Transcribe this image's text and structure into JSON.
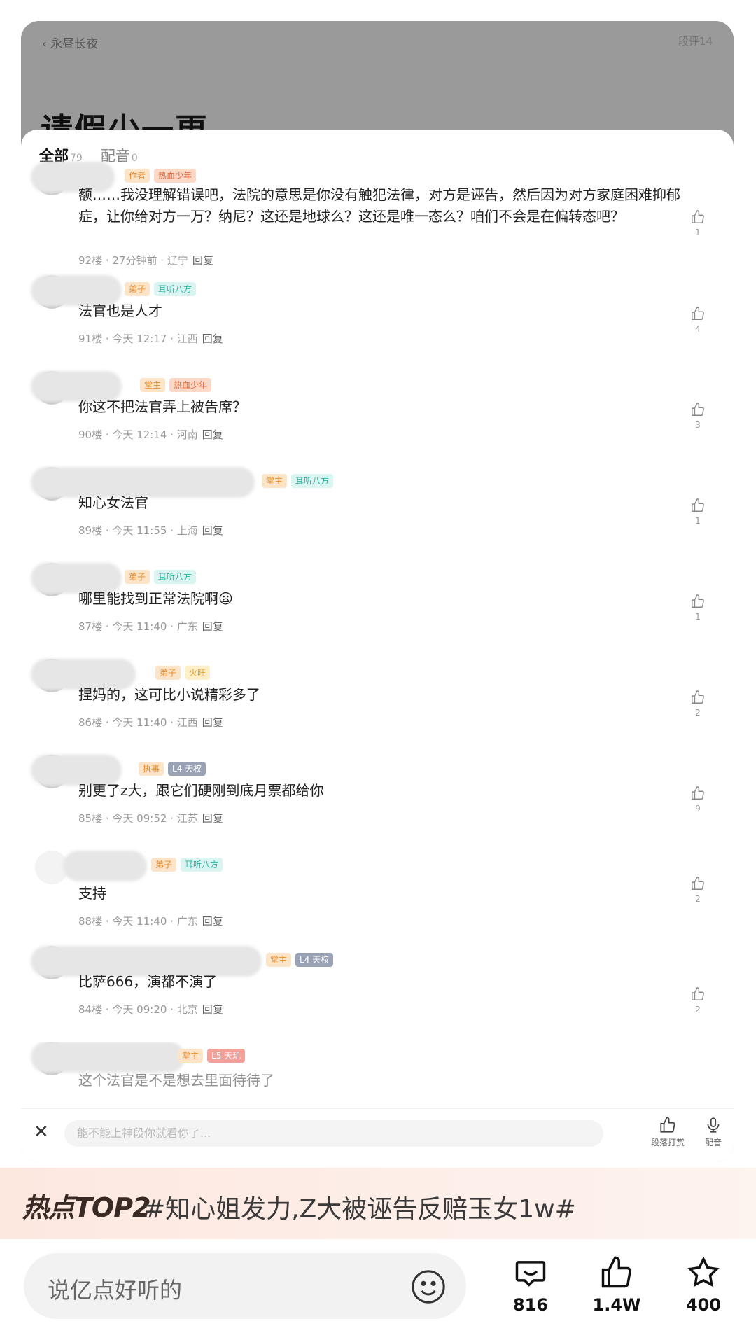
{
  "header": {
    "back_label": "永昼长夜",
    "paragraph_count": "段评14",
    "chapter_title": "请假少一更"
  },
  "tabs": [
    {
      "label": "全部",
      "count": "79"
    },
    {
      "label": "配音",
      "count": "0"
    }
  ],
  "comments": [
    {
      "badges": [
        "作者",
        "热血少年"
      ],
      "text": "额……我没理解错误吧，法院的意思是你没有触犯法律，对方是诬告，然后因为对方家庭困难抑郁症，让你给对方一万？纳尼？这还是地球么？这还是唯一态么？咱们不会是在偏转态吧？",
      "floor": "92楼",
      "time": "27分钟前",
      "region": "辽宁",
      "reply": "回复",
      "likes": "1"
    },
    {
      "badges": [
        "弟子",
        "耳听八方"
      ],
      "text": "法官也是人才",
      "floor": "91楼",
      "time": "今天 12:17",
      "region": "江西",
      "reply": "回复",
      "likes": "4"
    },
    {
      "badges": [
        "堂主",
        "热血少年"
      ],
      "text": "你这不把法官弄上被告席？",
      "floor": "90楼",
      "time": "今天 12:14",
      "region": "河南",
      "reply": "回复",
      "likes": "3"
    },
    {
      "badges": [
        "堂主",
        "耳听八方"
      ],
      "text": "知心女法官",
      "floor": "89楼",
      "time": "今天 11:55",
      "region": "上海",
      "reply": "回复",
      "likes": "1"
    },
    {
      "badges": [
        "弟子",
        "耳听八方"
      ],
      "text": "哪里能找到正常法院啊😦",
      "floor": "87楼",
      "time": "今天 11:40",
      "region": "广东",
      "reply": "回复",
      "likes": "1"
    },
    {
      "badges": [
        "弟子",
        "火旺"
      ],
      "text": "捏妈的，这可比小说精彩多了",
      "floor": "86楼",
      "time": "今天 11:40",
      "region": "江西",
      "reply": "回复",
      "likes": "2"
    },
    {
      "badges": [
        "执事",
        "L4 天权"
      ],
      "text": "别更了z大，跟它们硬刚到底月票都给你",
      "floor": "85楼",
      "time": "今天 09:52",
      "region": "江苏",
      "reply": "回复",
      "likes": "9"
    },
    {
      "badges": [
        "弟子",
        "耳听八方"
      ],
      "text": "支持",
      "floor": "88楼",
      "time": "今天 11:40",
      "region": "广东",
      "reply": "回复",
      "likes": "2"
    },
    {
      "badges": [
        "堂主",
        "L4 天权"
      ],
      "text": "比萨666，演都不演了",
      "floor": "84楼",
      "time": "今天 09:20",
      "region": "北京",
      "reply": "回复",
      "likes": "2"
    },
    {
      "badges": [
        "堂主",
        "L5 天玑"
      ],
      "text": "这个法官是不是想去里面待待了",
      "floor": "",
      "time": "",
      "region": "",
      "reply": "",
      "likes": ""
    }
  ],
  "reply_bar": {
    "placeholder": "能不能上神段你就看你了...",
    "tool_reward": "段落打赏",
    "tool_dub": "配音"
  },
  "hot": {
    "label": "热点TOP2",
    "topic": "#知心姐发力,Z大被诬告反赔玉女1w#"
  },
  "bottom": {
    "input_placeholder": "说亿点好听的",
    "comments": "816",
    "likes": "1.4W",
    "favorites": "400"
  }
}
